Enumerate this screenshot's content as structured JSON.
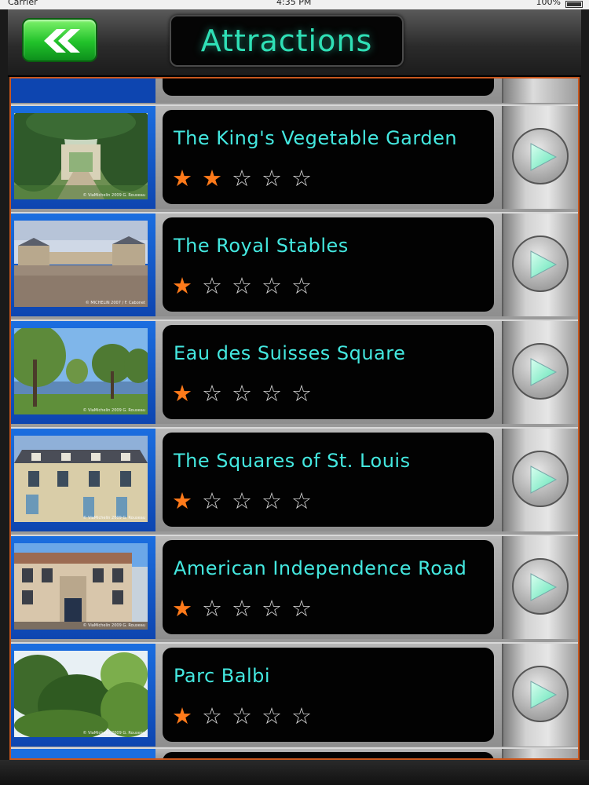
{
  "status_bar": {
    "carrier": "Carrier",
    "time": "4:35 PM",
    "battery": "100%"
  },
  "header": {
    "title": "Attractions",
    "back_icon": "double-chevron-left-icon"
  },
  "colors": {
    "title": "#2fe0b6",
    "item_title": "#44e8e0",
    "star_filled": "#ff7a1a",
    "star_empty": "#d9d9d9",
    "back_button": "#21c22a",
    "list_border": "#c9571e",
    "thumb_frame": "#1b6ee0"
  },
  "attractions": [
    {
      "title": "The King's Vegetable Garden",
      "rating": 2,
      "max_rating": 5,
      "photo": "garden-archway-photo",
      "credit": "© ViaMichelin 2009 G. Rouxeau"
    },
    {
      "title": "The Royal Stables",
      "rating": 1,
      "max_rating": 5,
      "photo": "palace-courtyard-photo",
      "credit": "© MICHELIN 2007 / F. Cabonet"
    },
    {
      "title": "Eau des Suisses Square",
      "rating": 1,
      "max_rating": 5,
      "photo": "lakeside-trees-photo",
      "credit": "© ViaMichelin 2009 G. Rouxeau"
    },
    {
      "title": "The Squares of St. Louis",
      "rating": 1,
      "max_rating": 5,
      "photo": "townhouse-facade-photo",
      "credit": "© ViaMichelin 2009 G. Rouxeau"
    },
    {
      "title": "American Independence Road",
      "rating": 1,
      "max_rating": 5,
      "photo": "building-facade-photo",
      "credit": "© ViaMichelin 2009 G. Rouxeau"
    },
    {
      "title": "Parc Balbi",
      "rating": 1,
      "max_rating": 5,
      "photo": "park-greenery-photo",
      "credit": "© ViaMichelin 2009 G. Rouxeau"
    }
  ],
  "icons": {
    "star_filled": "★",
    "star_empty": "☆",
    "go": "play-arrow-icon"
  }
}
